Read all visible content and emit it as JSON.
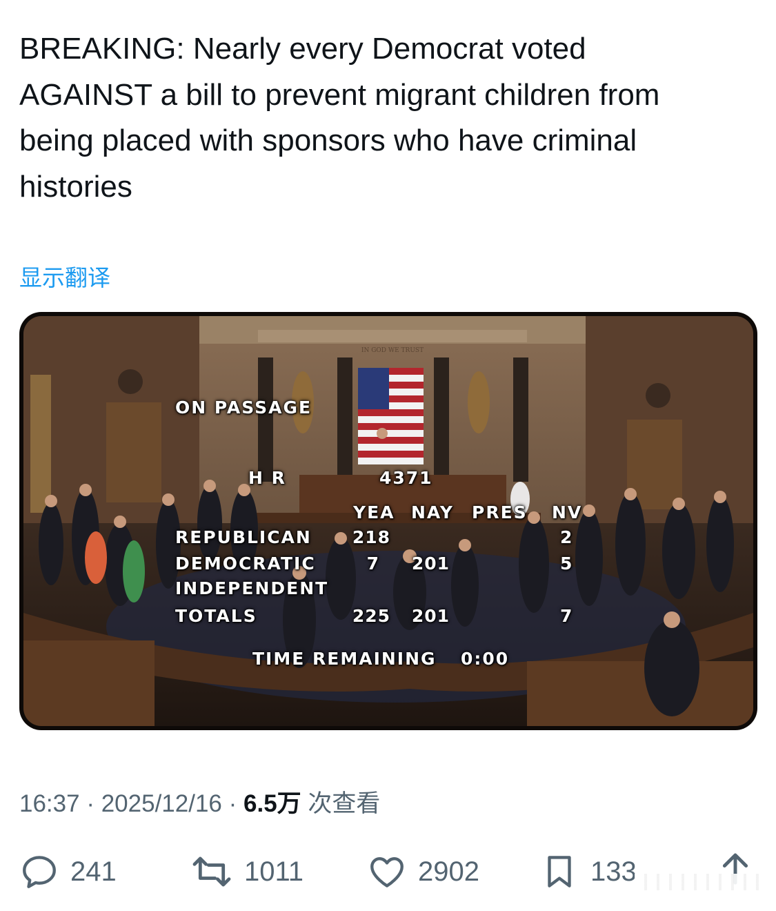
{
  "tweet": {
    "lines": [
      "BREAKING: Nearly every Democrat voted",
      "AGAINST a bill to prevent migrant children from",
      "being placed with sponsors who have criminal",
      "histories"
    ],
    "translate_label": "显示翻译"
  },
  "media": {
    "motto": "IN GOD WE TRUST",
    "vote_board": {
      "title": "ON PASSAGE",
      "bill_label": "H R",
      "bill_number": "4371",
      "columns": [
        "YEA",
        "NAY",
        "PRES",
        "NV"
      ],
      "rows": [
        {
          "party": "REPUBLICAN",
          "yea": "218",
          "nay": "",
          "pres": "",
          "nv": "2"
        },
        {
          "party": "DEMOCRATIC",
          "yea": "7",
          "nay": "201",
          "pres": "",
          "nv": "5"
        },
        {
          "party": "INDEPENDENT",
          "yea": "",
          "nay": "",
          "pres": "",
          "nv": ""
        },
        {
          "party": "TOTALS",
          "yea": "225",
          "nay": "201",
          "pres": "",
          "nv": "7"
        }
      ],
      "time_label": "TIME REMAINING",
      "time_value": "0:00"
    }
  },
  "meta": {
    "time": "16:37",
    "sep": "·",
    "date": "2025/12/16",
    "views": "6.5万",
    "views_suffix": "次查看"
  },
  "actions": {
    "replies": "241",
    "reposts": "1011",
    "likes": "2902",
    "bookmarks": "133"
  },
  "icons": [
    "reply-icon",
    "repost-icon",
    "like-icon",
    "bookmark-icon",
    "share-icon"
  ],
  "colors": {
    "link": "#1d9bf0",
    "secondary_text": "#536471",
    "primary_text": "#0f1419"
  }
}
